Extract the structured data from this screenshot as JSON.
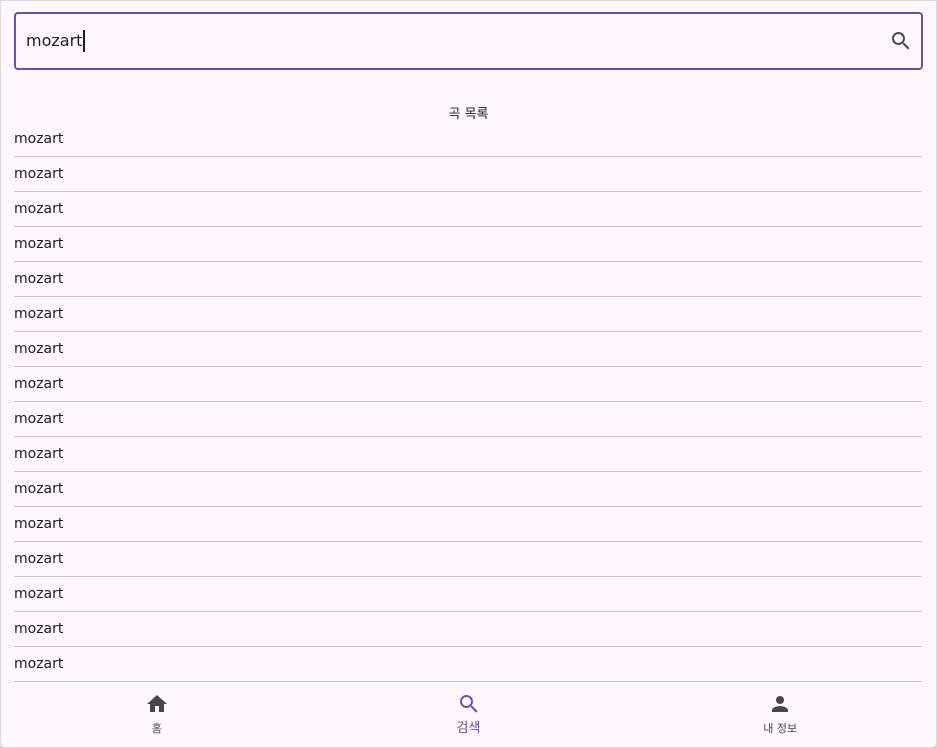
{
  "search": {
    "value": "mozart",
    "icon": "search-icon"
  },
  "list": {
    "title": "곡 목록",
    "items": [
      "mozart",
      "mozart",
      "mozart",
      "mozart",
      "mozart",
      "mozart",
      "mozart",
      "mozart",
      "mozart",
      "mozart",
      "mozart",
      "mozart",
      "mozart",
      "mozart",
      "mozart",
      "mozart"
    ]
  },
  "nav": {
    "items": [
      {
        "label": "홈",
        "icon": "home-icon",
        "active": false
      },
      {
        "label": "검색",
        "icon": "search-icon",
        "active": true
      },
      {
        "label": "내 정보",
        "icon": "person-icon",
        "active": false
      }
    ]
  },
  "colors": {
    "accent": "#6750a4",
    "background": "#fef7ff",
    "text": "#1d1b20",
    "icon_inactive": "#49454f",
    "divider": "#cac4d0"
  }
}
